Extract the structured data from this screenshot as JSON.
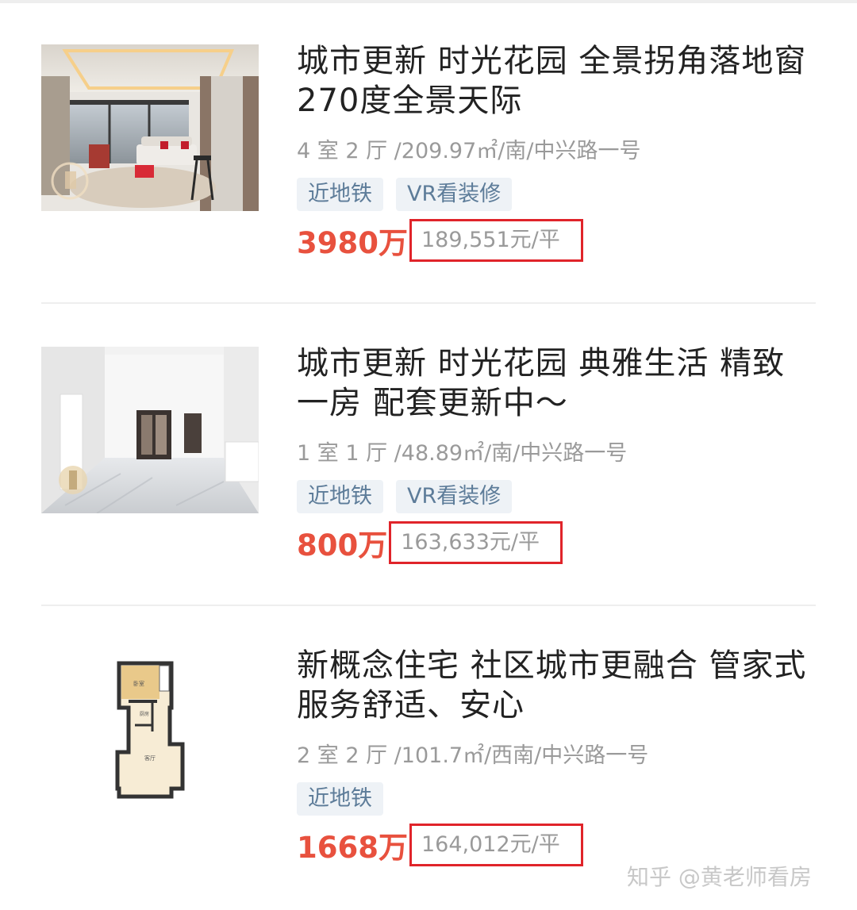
{
  "listings": [
    {
      "title": "城市更新 时光花园 全景拐角落地窗 270度全景天际",
      "meta": "4 室 2 厅 /209.97㎡/南/中兴路一号",
      "tags": [
        "近地铁",
        "VR看装修"
      ],
      "price": "3980万",
      "unit_price": "189,551元/平",
      "image": "living-room-photo"
    },
    {
      "title": "城市更新 时光花园 典雅生活 精致一房 配套更新中～",
      "meta": "1 室 1 厅 /48.89㎡/南/中兴路一号",
      "tags": [
        "近地铁",
        "VR看装修"
      ],
      "price": "800万",
      "unit_price": "163,633元/平",
      "image": "interior-hall-photo"
    },
    {
      "title": "新概念住宅 社区城市更融合 管家式服务舒适、安心",
      "meta": "2 室 2 厅 /101.7㎡/西南/中兴路一号",
      "tags": [
        "近地铁"
      ],
      "price": "1668万",
      "unit_price": "164,012元/平",
      "image": "floor-plan"
    }
  ],
  "watermark": "知乎 @黄老师看房",
  "colors": {
    "price": "#e8513e",
    "highlight_box": "#e0242a",
    "tag_bg": "#eef2f6",
    "tag_text": "#5d7c99"
  }
}
